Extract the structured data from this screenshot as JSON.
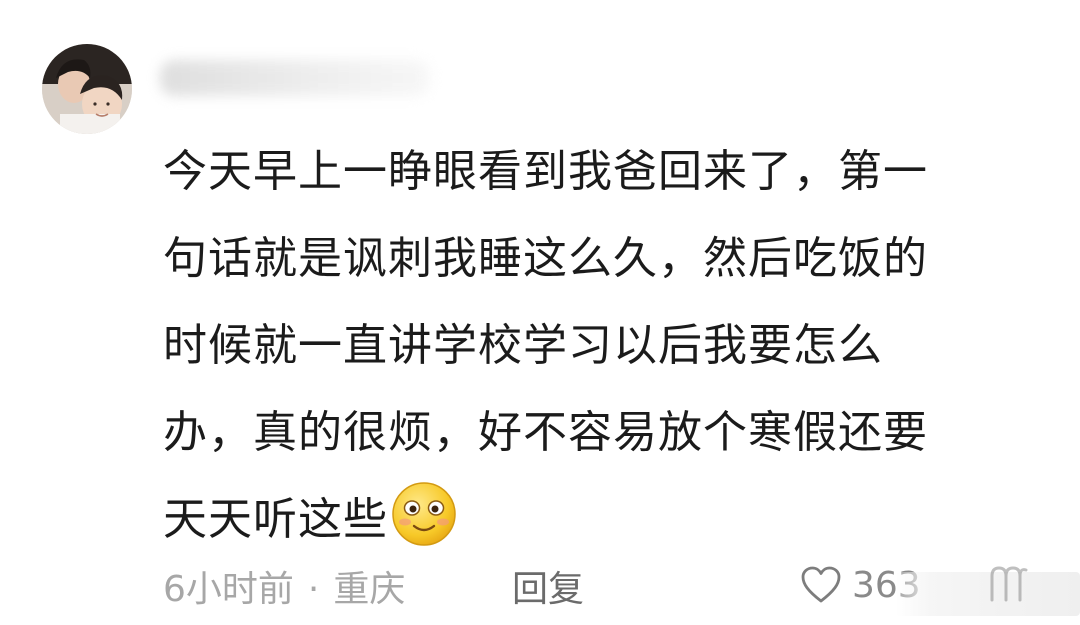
{
  "comment": {
    "content_lines": [
      "今天早上一睁眼看到我爸回来了，第一",
      "句话就是讽刺我睡这么久，然后吃饭的",
      "时候就一直讲学校学习以后我要怎么",
      "办，真的很烦，好不容易放个寒假还要",
      "天天听这些"
    ],
    "emoji": "smiling-face-emoji",
    "time": "6小时前",
    "separator": "·",
    "location": "重庆",
    "reply_label": "回复",
    "like_count": "363"
  },
  "icons": {
    "like": "heart-outline-icon",
    "more": "more-options-icon"
  },
  "colors": {
    "text": "#1b1b1b",
    "meta": "#a7a7a7",
    "reply": "#6b6b6b"
  }
}
